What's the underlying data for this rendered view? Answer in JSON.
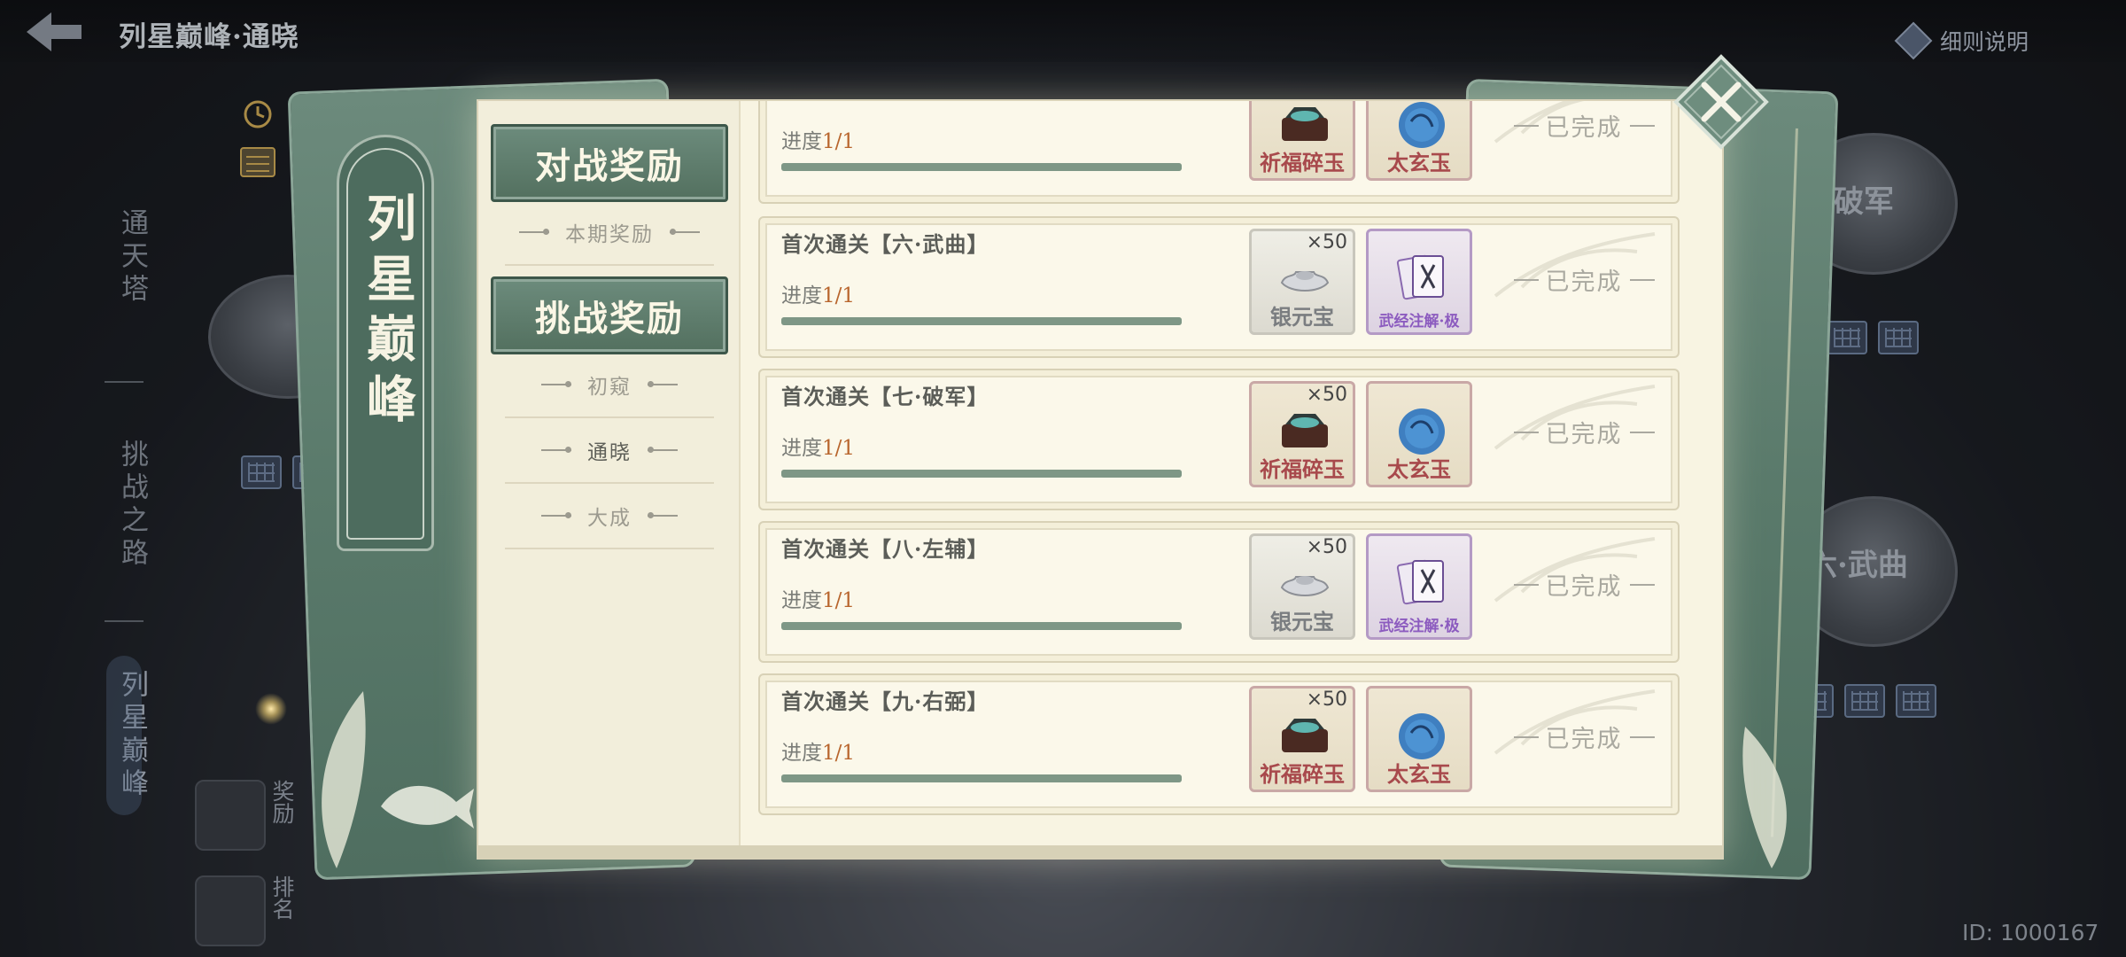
{
  "header": {
    "title": "列星巅峰·通晓",
    "rules_label": "细则说明"
  },
  "side_nav": {
    "items": [
      "通天塔",
      "挑战之路",
      "列星巅峰"
    ]
  },
  "bottom_buttons": [
    {
      "label": "奖励"
    },
    {
      "label": "排名"
    }
  ],
  "background_discs": [
    {
      "label": "破军"
    },
    {
      "label": "六·武曲"
    }
  ],
  "user_id": "ID: 1000167",
  "book": {
    "spine_title": "列星巅峰"
  },
  "tabs": {
    "battle": {
      "label": "对战奖励",
      "subs": [
        "本期奖励"
      ]
    },
    "challenge": {
      "label": "挑战奖励",
      "subs": [
        "初窥",
        "通晓",
        "大成"
      ],
      "active_sub": "通晓"
    }
  },
  "rewards": [
    {
      "title": "",
      "progress_label": "进度",
      "progress_value": "1/1",
      "progress_fraction": 1.0,
      "items": [
        {
          "name": "祈福碎玉",
          "count": "",
          "rarity": "red",
          "icon": "jade-chest-icon"
        },
        {
          "name": "太玄玉",
          "count": "",
          "rarity": "red",
          "icon": "blue-jade-icon"
        }
      ],
      "status": "已完成"
    },
    {
      "title": "首次通关【六·武曲】",
      "progress_label": "进度",
      "progress_value": "1/1",
      "progress_fraction": 1.0,
      "items": [
        {
          "name": "银元宝",
          "count": "×50",
          "rarity": "grey",
          "icon": "silver-ingot-icon"
        },
        {
          "name": "武经注解·极",
          "count": "",
          "rarity": "purple",
          "icon": "martial-manual-icon"
        }
      ],
      "status": "已完成"
    },
    {
      "title": "首次通关【七·破军】",
      "progress_label": "进度",
      "progress_value": "1/1",
      "progress_fraction": 1.0,
      "items": [
        {
          "name": "祈福碎玉",
          "count": "×50",
          "rarity": "red",
          "icon": "jade-chest-icon"
        },
        {
          "name": "太玄玉",
          "count": "",
          "rarity": "red",
          "icon": "blue-jade-icon"
        }
      ],
      "status": "已完成"
    },
    {
      "title": "首次通关【八·左辅】",
      "progress_label": "进度",
      "progress_value": "1/1",
      "progress_fraction": 1.0,
      "items": [
        {
          "name": "银元宝",
          "count": "×50",
          "rarity": "grey",
          "icon": "silver-ingot-icon"
        },
        {
          "name": "武经注解·极",
          "count": "",
          "rarity": "purple",
          "icon": "martial-manual-icon"
        }
      ],
      "status": "已完成"
    },
    {
      "title": "首次通关【九·右弼】",
      "progress_label": "进度",
      "progress_value": "1/1",
      "progress_fraction": 1.0,
      "items": [
        {
          "name": "祈福碎玉",
          "count": "×50",
          "rarity": "red",
          "icon": "jade-chest-icon"
        },
        {
          "name": "太玄玉",
          "count": "",
          "rarity": "red",
          "icon": "blue-jade-icon"
        }
      ],
      "status": "已完成"
    }
  ],
  "colors": {
    "accent_green": "#5a7a6b",
    "progress_orange": "#b8652d",
    "paper": "#f8f4e2"
  }
}
